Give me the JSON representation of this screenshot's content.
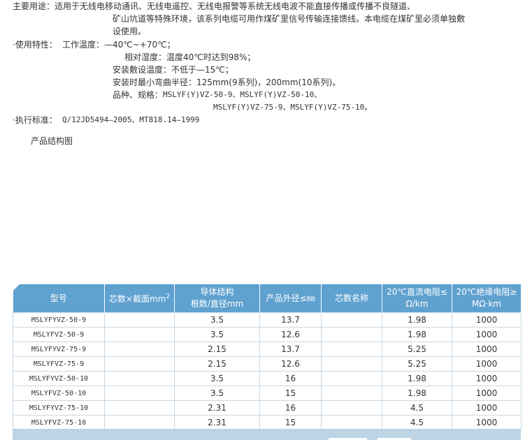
{
  "usage": {
    "label": "主要用途：",
    "lines": [
      "适用于无线电移动通讯、无线电遥控、无线电报警等系统无线电波不能直接传播或传播不良隧道、",
      "矿山坑道等特殊环境，该系列电缆可用作煤矿里信号传输连接馈线。本电缆在煤矿里必须单独敷",
      "设使用。"
    ]
  },
  "features": {
    "label": "·使用特性：",
    "temp_label": "工作温度：",
    "temp_value": "—40℃~+70℃；",
    "humidity_label": "相对湿度：",
    "humidity_value": "温度40℃时达到98%；",
    "install_label": "安装敷设温度：",
    "install_value": "不低于—15℃；",
    "bend_label": "安装时最小弯曲半径：",
    "bend_value": "125mm(9系列)，200mm(10系列)。",
    "models_label": "品种、规格：",
    "models_line1": "MSLYF(Y)VZ-50-9、MSLYF(Y)VZ-50-10、",
    "models_line2": "MSLYF(Y)VZ-75-9、MSLYF(Y)VZ-75-10。"
  },
  "standard": {
    "label": "·执行标准：",
    "value": "Q/12JD5494—2005、MT818.14—1999"
  },
  "structure_title": "产品结构图",
  "table": {
    "headers": {
      "model": "型号",
      "cores_section": "芯数×截面mm",
      "cores_section_sup": "2",
      "conductor_1": "导体结构",
      "conductor_2": "根数/直径mm",
      "outer_diameter": "产品外径≤㎜",
      "core_name": "芯数名称",
      "dc_resistance_1": "20℃直流电阻≤",
      "dc_resistance_2": "Ω/km",
      "insulation_resistance_1": "20℃绝缘电阻≥",
      "insulation_resistance_2": "MΩ·km"
    },
    "rows": [
      [
        "MSLYFYVZ-50-9",
        "",
        "3.5",
        "13.7",
        "",
        "1.98",
        "1000"
      ],
      [
        "MSLYFVZ-50-9",
        "",
        "3.5",
        "12.6",
        "",
        "1.98",
        "1000"
      ],
      [
        "MSLYFYVZ-75-9",
        "",
        "2.15",
        "13.7",
        "",
        "5.25",
        "1000"
      ],
      [
        "MSLYFVZ-75-9",
        "",
        "2.15",
        "12.6",
        "",
        "5.25",
        "1000"
      ],
      [
        "MSLYFYVZ-50-10",
        "",
        "3.5",
        "16",
        "",
        "1.98",
        "1000"
      ],
      [
        "MSLYFVZ-50-10",
        "",
        "3.5",
        "15",
        "",
        "1.98",
        "1000"
      ],
      [
        "MSLYFYVZ-75-10",
        "",
        "2.31",
        "16",
        "",
        "4.5",
        "1000"
      ],
      [
        "MSLYFVZ-75-10",
        "",
        "2.31",
        "15",
        "",
        "4.5",
        "1000"
      ]
    ]
  },
  "colors": {
    "header_bg": "#5fa1cf",
    "grid_line": "#c5d8e6",
    "footer_bg": "#bcd4e4"
  }
}
